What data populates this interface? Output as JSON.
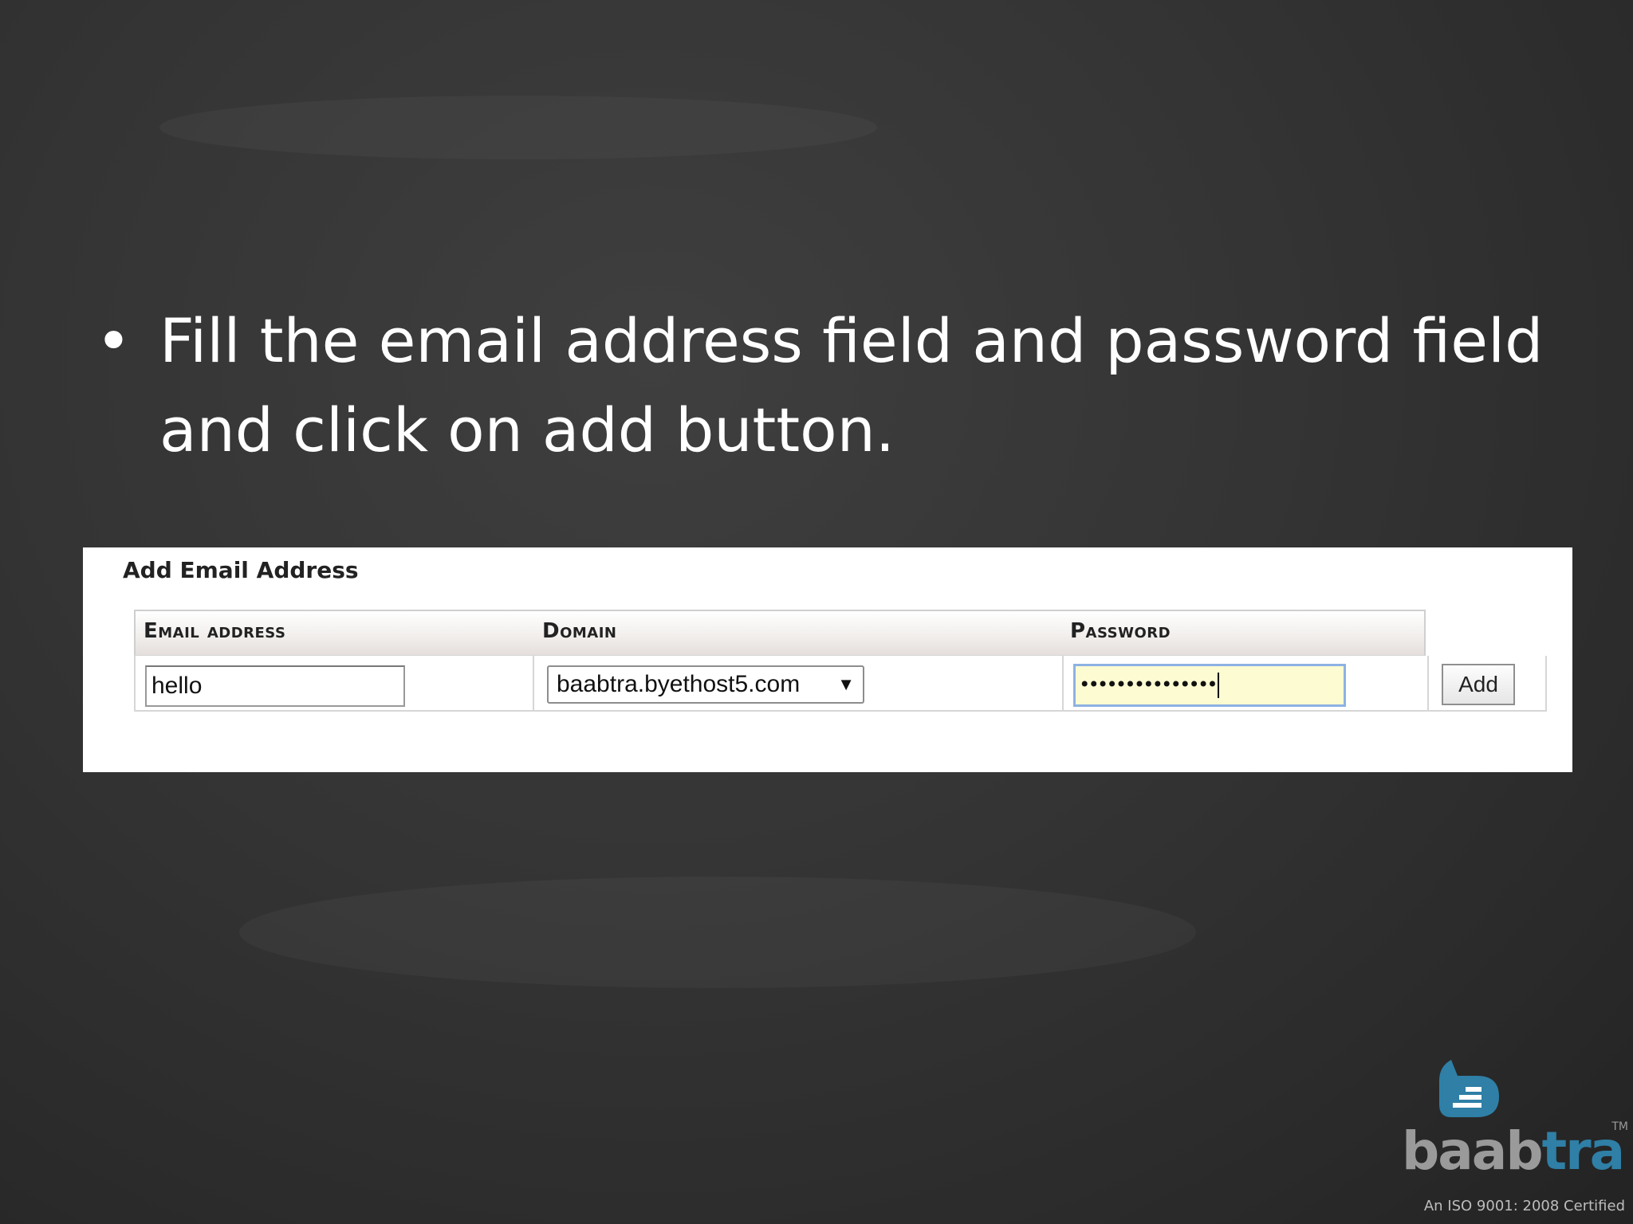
{
  "slide": {
    "bullet_symbol": "•",
    "bullet_line1": "Fill the email address field and password field",
    "bullet_line2": "and click on add button."
  },
  "form": {
    "title": "Add Email Address",
    "headers": {
      "email": "Email address",
      "domain": "Domain",
      "password": "Password"
    },
    "email_value": "hello",
    "domain_value": "baabtra.byethost5.com",
    "password_masked": "•••••••••••••••",
    "add_label": "Add"
  },
  "branding": {
    "logo_part1": "baab",
    "logo_part2": "tra",
    "trademark": "TM",
    "iso_text": "An ISO 9001: 2008 Certified",
    "logo_color": "#2f7fa6"
  }
}
